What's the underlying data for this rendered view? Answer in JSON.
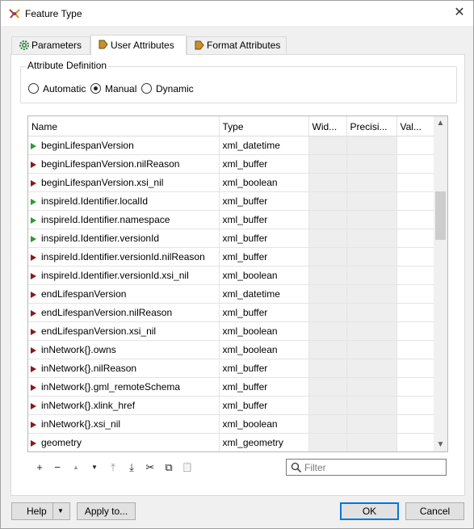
{
  "window": {
    "title": "Feature Type",
    "close_label": "✕"
  },
  "tabs": [
    {
      "label": "Parameters",
      "icon": "gear-icon"
    },
    {
      "label": "User Attributes",
      "icon": "arrow-tag-icon"
    },
    {
      "label": "Format Attributes",
      "icon": "arrow-tag-icon"
    }
  ],
  "active_tab": "User Attributes",
  "attribute_definition": {
    "legend": "Attribute Definition",
    "options": [
      "Automatic",
      "Manual",
      "Dynamic"
    ],
    "selected": "Manual"
  },
  "table": {
    "columns": [
      "Name",
      "Type",
      "Wid...",
      "Precisi...",
      "Val..."
    ],
    "rows": [
      {
        "name": "beginLifespanVersion",
        "type": "xml_datetime",
        "marker": "green"
      },
      {
        "name": "beginLifespanVersion.nilReason",
        "type": "xml_buffer",
        "marker": "red"
      },
      {
        "name": "beginLifespanVersion.xsi_nil",
        "type": "xml_boolean",
        "marker": "red"
      },
      {
        "name": "inspireId.Identifier.localId",
        "type": "xml_buffer",
        "marker": "green"
      },
      {
        "name": "inspireId.Identifier.namespace",
        "type": "xml_buffer",
        "marker": "green"
      },
      {
        "name": "inspireId.Identifier.versionId",
        "type": "xml_buffer",
        "marker": "green"
      },
      {
        "name": "inspireId.Identifier.versionId.nilReason",
        "type": "xml_buffer",
        "marker": "red"
      },
      {
        "name": "inspireId.Identifier.versionId.xsi_nil",
        "type": "xml_boolean",
        "marker": "red"
      },
      {
        "name": "endLifespanVersion",
        "type": "xml_datetime",
        "marker": "red"
      },
      {
        "name": "endLifespanVersion.nilReason",
        "type": "xml_buffer",
        "marker": "red"
      },
      {
        "name": "endLifespanVersion.xsi_nil",
        "type": "xml_boolean",
        "marker": "red"
      },
      {
        "name": "inNetwork{}.owns",
        "type": "xml_boolean",
        "marker": "red"
      },
      {
        "name": "inNetwork{}.nilReason",
        "type": "xml_buffer",
        "marker": "red"
      },
      {
        "name": "inNetwork{}.gml_remoteSchema",
        "type": "xml_buffer",
        "marker": "red"
      },
      {
        "name": "inNetwork{}.xlink_href",
        "type": "xml_buffer",
        "marker": "red"
      },
      {
        "name": "inNetwork{}.xsi_nil",
        "type": "xml_boolean",
        "marker": "red"
      },
      {
        "name": "geometry",
        "type": "xml_geometry",
        "marker": "red"
      }
    ],
    "scroll_up": "▲",
    "scroll_down": "▼"
  },
  "toolbar": {
    "add": "+",
    "remove": "−",
    "move_up": "▲",
    "move_down": "▼",
    "move_top": "⤒",
    "move_bottom": "⤓",
    "cut": "✂",
    "copy": "⧉",
    "paste": "📋"
  },
  "filter": {
    "placeholder": "Filter",
    "value": ""
  },
  "footer": {
    "help": "Help",
    "help_caret": "▼",
    "apply_to": "Apply to...",
    "ok": "OK",
    "cancel": "Cancel"
  },
  "colors": {
    "marker_red": "#8b1a1a",
    "marker_green": "#2e9b2e",
    "primary_border": "#0078d7"
  }
}
